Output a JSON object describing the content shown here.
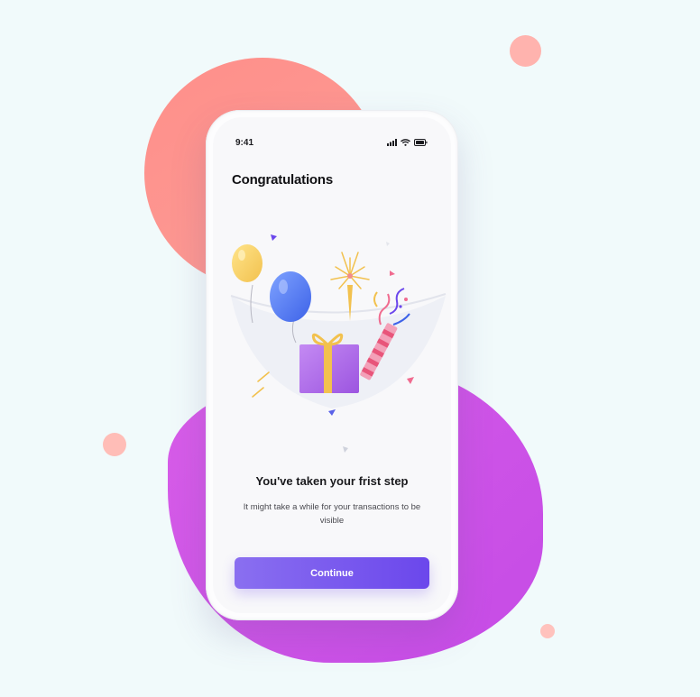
{
  "status_bar": {
    "time": "9:41"
  },
  "header": {
    "title": "Congratulations"
  },
  "message": {
    "heading": "You've taken your frist step",
    "body": "It might take a while for your transactions to be visible"
  },
  "actions": {
    "continue_label": "Continue"
  },
  "colors": {
    "background": "#f1fafb",
    "coral_blob": "#ff8f8a",
    "purple_blob": "#d85ee8",
    "button_start": "#8a6ff0",
    "button_end": "#6b47ec"
  },
  "icons": [
    "signal-icon",
    "wifi-icon",
    "battery-icon",
    "celebration-illustration"
  ]
}
